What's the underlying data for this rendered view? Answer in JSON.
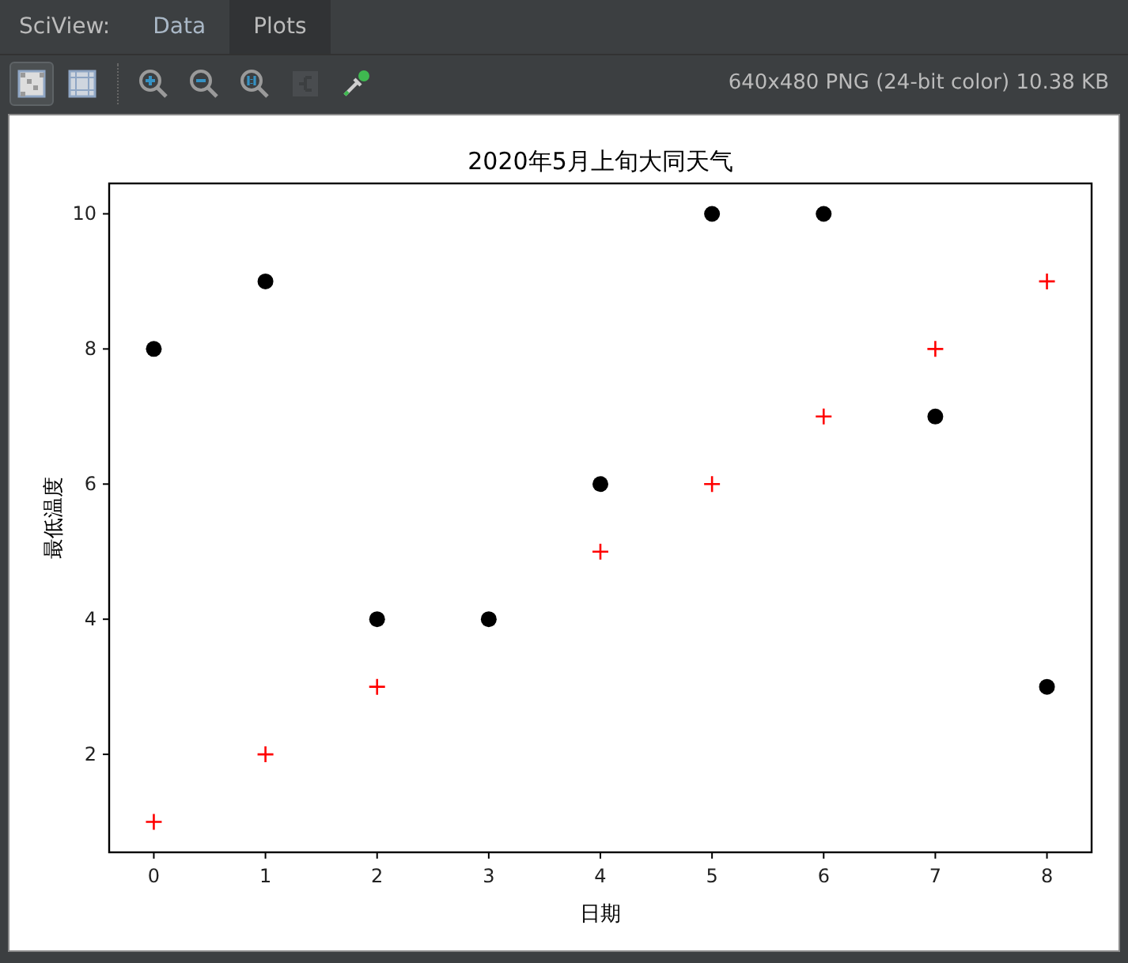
{
  "header": {
    "label": "SciView:"
  },
  "tabs": [
    {
      "label": "Data",
      "selected": false
    },
    {
      "label": "Plots",
      "selected": true
    }
  ],
  "toolbar": {
    "tools": [
      {
        "kind": "checker",
        "selected": true,
        "disabled": false
      },
      {
        "kind": "grid",
        "selected": false,
        "disabled": false
      },
      {
        "kind": "zoom-in",
        "selected": false,
        "disabled": false
      },
      {
        "kind": "zoom-out",
        "selected": false,
        "disabled": false
      },
      {
        "kind": "zoom-actual",
        "selected": false,
        "disabled": false
      },
      {
        "kind": "export",
        "selected": false,
        "disabled": true
      },
      {
        "kind": "picker",
        "selected": false,
        "disabled": false
      }
    ],
    "image_info": "640x480 PNG (24-bit color) 10.38 KB"
  },
  "plot": {
    "chart_data": {
      "type": "scatter",
      "title": "2020年5月上旬大同天气",
      "xlabel": "日期",
      "ylabel": "最低温度",
      "x": [
        0,
        1,
        2,
        3,
        4,
        5,
        6,
        7,
        8
      ],
      "series": [
        {
          "color": "#000000",
          "marker": "circle",
          "values": [
            8,
            9,
            4,
            4,
            6,
            10,
            10,
            7,
            3
          ]
        },
        {
          "color": "#ff0000",
          "marker": "plus",
          "values": [
            1,
            2,
            3,
            null,
            5,
            6,
            7,
            8,
            9
          ]
        }
      ],
      "xlim": [
        -0.4,
        8.4
      ],
      "ylim": [
        0.55,
        10.45
      ],
      "xticks": [
        0,
        1,
        2,
        3,
        4,
        5,
        6,
        7,
        8
      ],
      "yticks": [
        2,
        4,
        6,
        8,
        10
      ]
    }
  }
}
